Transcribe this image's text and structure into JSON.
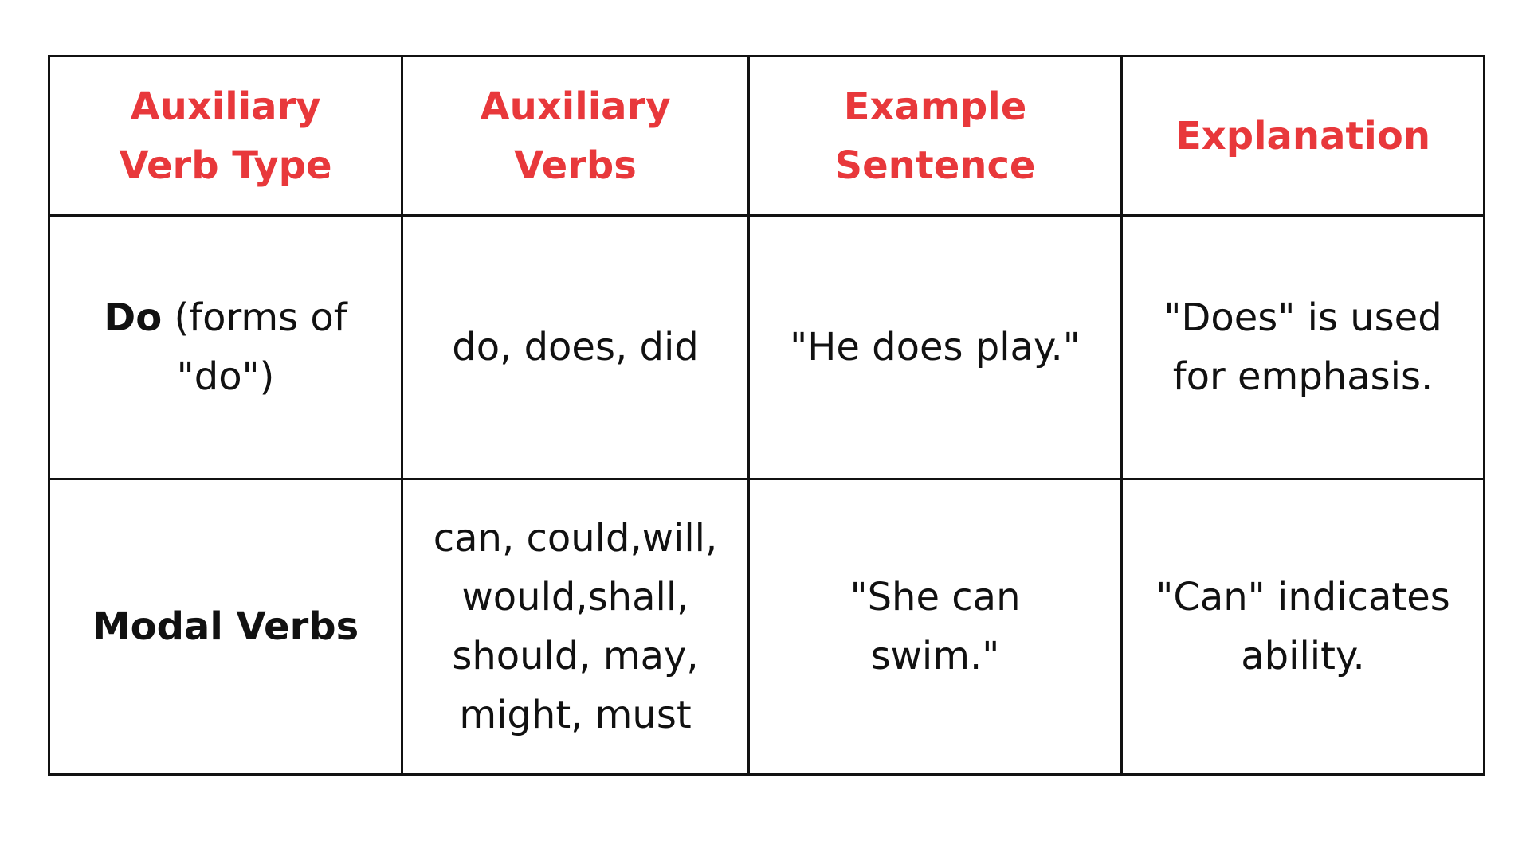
{
  "colors": {
    "header_text": "#e8383b",
    "body_text": "#111111",
    "border": "#111111"
  },
  "table": {
    "headers": [
      "Auxiliary Verb Type",
      "Auxiliary Verbs",
      "Example Sentence",
      "Explanation"
    ],
    "rows": [
      {
        "type_bold": "Do",
        "type_rest": " (forms of \"do\")",
        "verbs": "do, does, did",
        "example": "\"He does play.\"",
        "explanation": "\"Does\" is used for emphasis."
      },
      {
        "type_bold": "Modal Verbs",
        "type_rest": "",
        "verbs": "can, could,will, would,shall, should, may, might, must",
        "example": "\"She can swim.\"",
        "explanation": "\"Can\" indicates ability."
      }
    ]
  }
}
